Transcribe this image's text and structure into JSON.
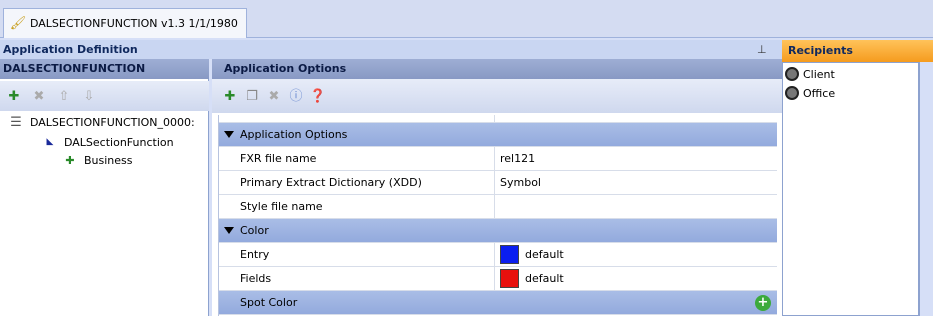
{
  "tab": {
    "label": "DALSECTIONFUNCTION v1.3 1/1/1980",
    "icon": "brush-icon"
  },
  "app_definition": {
    "header": "Application Definition",
    "tree_title": "DALSECTIONFUNCTION",
    "tree": [
      {
        "label": "DALSECTIONFUNCTION_0000:",
        "icon": "document-icon"
      },
      {
        "label": "DALSectionFunction",
        "icon": "section-icon"
      },
      {
        "label": "Business",
        "icon": "function-icon"
      }
    ]
  },
  "options": {
    "title": "Application Options",
    "rows": [
      {
        "type": "category",
        "label": "Application Options"
      },
      {
        "type": "prop",
        "name": "FXR file name",
        "value": "rel121"
      },
      {
        "type": "prop",
        "name": "Primary Extract Dictionary (XDD)",
        "value": "Symbol"
      },
      {
        "type": "prop",
        "name": "Style file name",
        "value": ""
      },
      {
        "type": "category",
        "label": "Color"
      },
      {
        "type": "prop",
        "name": "Entry",
        "value": "default",
        "swatch": "#0a1ef0"
      },
      {
        "type": "prop",
        "name": "Fields",
        "value": "default",
        "swatch": "#e8100d"
      },
      {
        "type": "category",
        "label": "Spot Color"
      }
    ]
  },
  "recipients": {
    "header": "Recipients",
    "items": [
      {
        "label": "Client"
      },
      {
        "label": "Office"
      }
    ]
  }
}
